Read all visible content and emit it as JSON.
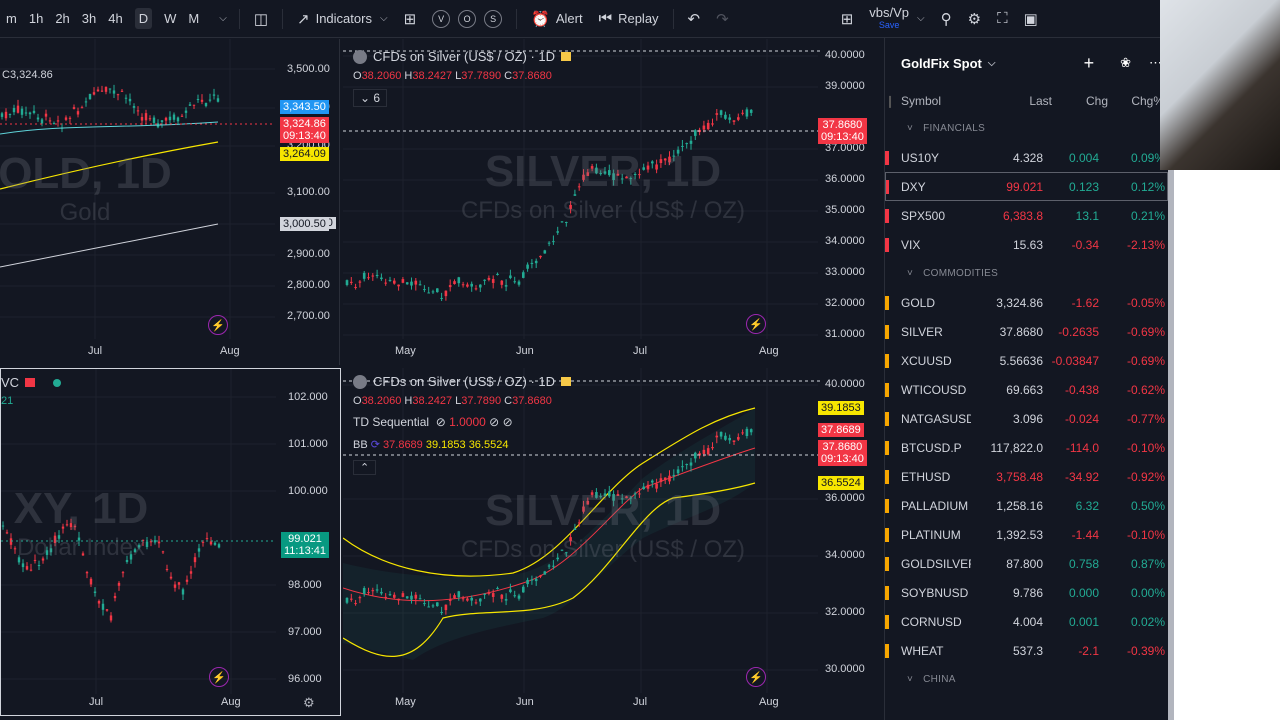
{
  "toolbar": {
    "intervals": [
      "m",
      "1h",
      "2h",
      "3h",
      "4h",
      "D",
      "W",
      "M"
    ],
    "active_interval": "D",
    "indicators": "Indicators",
    "alert": "Alert",
    "replay": "Replay",
    "layout_name": "vbs/Vp",
    "save_label": "Save",
    "circle_buttons": [
      "V",
      "O",
      "S"
    ]
  },
  "gold_pane": {
    "ohlc_fragment": "C3,324.86",
    "watermark": "OLD, 1D",
    "watermark_sub": "Gold",
    "price_scale": [
      "3,500.00",
      "3,300.00",
      "3,200.00",
      "3,100.00",
      "3,000.50",
      "2,900.00",
      "2,800.00",
      "2,700.00"
    ],
    "tags": [
      {
        "text": "3,343.50",
        "color": "#2196f3"
      },
      {
        "text": "3,324.86",
        "sub": "09:13:40",
        "color": "#f23645"
      },
      {
        "text": "3,264.09",
        "color": "#f7e600"
      },
      {
        "text": "3,000.50",
        "color": "#d1d4dc"
      }
    ],
    "x_labels": [
      "Jul",
      "Aug"
    ]
  },
  "silver_top": {
    "title": "CFDs on Silver (US$ / OZ) · 1D",
    "ohlc": {
      "o": "38.2060",
      "h": "38.2427",
      "l": "37.7890",
      "c": "37.8680"
    },
    "collapse_count": "6",
    "watermark": "SILVER, 1D",
    "watermark_sub": "CFDs on Silver (US$ / OZ)",
    "price_scale": [
      "40.0000",
      "39.0000",
      "37.0000",
      "36.0000",
      "35.0000",
      "34.0000",
      "33.0000",
      "32.0000",
      "31.0000"
    ],
    "tag": {
      "text": "37.8680",
      "sub": "09:13:40"
    },
    "x_labels": [
      "May",
      "Jun",
      "Jul",
      "Aug"
    ]
  },
  "dxy_pane": {
    "title": "VC",
    "sub": "21",
    "watermark": "XY, 1D",
    "watermark_sub": "Dollar Index",
    "price_scale": [
      "102.000",
      "101.000",
      "100.000",
      "98.000",
      "97.000",
      "96.000"
    ],
    "tag": {
      "text": "99.021",
      "sub": "11:13:41"
    },
    "x_labels": [
      "Jul",
      "Aug"
    ]
  },
  "silver_bottom": {
    "title": "CFDs on Silver (US$ / OZ) · 1D",
    "ohlc": {
      "o": "38.2060",
      "h": "38.2427",
      "l": "37.7890",
      "c": "37.8680"
    },
    "td_label": "TD Sequential",
    "td_value": "1.0000",
    "bb_label": "BB",
    "bb_values": [
      "37.8689",
      "39.1853",
      "36.5524"
    ],
    "watermark": "SILVER, 1D",
    "watermark_sub": "CFDs on Silver (US$ / OZ)",
    "price_scale": [
      "40.0000",
      "36.0000",
      "34.0000",
      "32.0000",
      "30.0000"
    ],
    "tags": [
      {
        "text": "39.1853",
        "color": "#f7e600"
      },
      {
        "text": "37.8689",
        "color": "#f23645"
      },
      {
        "text": "37.8680",
        "sub": "09:13:40",
        "color": "#f23645"
      },
      {
        "text": "36.5524",
        "color": "#f7e600"
      }
    ],
    "x_labels": [
      "May",
      "Jun",
      "Jul",
      "Aug"
    ]
  },
  "watchlist": {
    "title": "GoldFix Spot",
    "columns": [
      "Symbol",
      "Last",
      "Chg",
      "Chg%"
    ],
    "sections": [
      {
        "name": "FINANCIALS",
        "rows": [
          {
            "sym": "US10Y",
            "last": "4.328",
            "chg": "0.004",
            "chgp": "0.09%",
            "dir": "pos",
            "color": "#f23645"
          },
          {
            "sym": "DXY",
            "last": "99.021",
            "chg": "0.123",
            "chgp": "0.12%",
            "dir": "pos",
            "color": "#f23645",
            "lastneg": true,
            "sel": true
          },
          {
            "sym": "SPX500",
            "last": "6,383.8",
            "chg": "13.1",
            "chgp": "0.21%",
            "dir": "pos",
            "color": "#f23645",
            "lastneg": true
          },
          {
            "sym": "VIX",
            "last": "15.63",
            "chg": "-0.34",
            "chgp": "-2.13%",
            "dir": "neg",
            "color": "#f23645"
          }
        ]
      },
      {
        "name": "COMMODITIES",
        "rows": [
          {
            "sym": "GOLD",
            "last": "3,324.86",
            "chg": "-1.62",
            "chgp": "-0.05%",
            "dir": "neg",
            "color": "#f7a600"
          },
          {
            "sym": "SILVER",
            "last": "37.8680",
            "chg": "-0.2635",
            "chgp": "-0.69%",
            "dir": "neg",
            "color": "#f7a600"
          },
          {
            "sym": "XCUUSD",
            "last": "5.56636",
            "chg": "-0.03847",
            "chgp": "-0.69%",
            "dir": "neg",
            "color": "#f7a600"
          },
          {
            "sym": "WTICOUSD",
            "last": "69.663",
            "chg": "-0.438",
            "chgp": "-0.62%",
            "dir": "neg",
            "color": "#f7a600"
          },
          {
            "sym": "NATGASUSD",
            "last": "3.096",
            "chg": "-0.024",
            "chgp": "-0.77%",
            "dir": "neg",
            "color": "#f7a600"
          },
          {
            "sym": "BTCUSD.P",
            "last": "117,822.0",
            "chg": "-114.0",
            "chgp": "-0.10%",
            "dir": "neg",
            "color": "#f7a600"
          },
          {
            "sym": "ETHUSD",
            "last": "3,758.48",
            "chg": "-34.92",
            "chgp": "-0.92%",
            "dir": "neg",
            "color": "#f7a600",
            "lastneg": true
          },
          {
            "sym": "PALLADIUM",
            "last": "1,258.16",
            "chg": "6.32",
            "chgp": "0.50%",
            "dir": "pos",
            "color": "#f7a600"
          },
          {
            "sym": "PLATINUM",
            "last": "1,392.53",
            "chg": "-1.44",
            "chgp": "-0.10%",
            "dir": "neg",
            "color": "#f7a600"
          },
          {
            "sym": "GOLDSILVER",
            "last": "87.800",
            "chg": "0.758",
            "chgp": "0.87%",
            "dir": "pos",
            "color": "#f7a600"
          },
          {
            "sym": "SOYBNUSD",
            "last": "9.786",
            "chg": "0.000",
            "chgp": "0.00%",
            "dir": "pos",
            "color": "#f7a600"
          },
          {
            "sym": "CORNUSD",
            "last": "4.004",
            "chg": "0.001",
            "chgp": "0.02%",
            "dir": "pos",
            "color": "#f7a600"
          },
          {
            "sym": "WHEAT",
            "last": "537.3",
            "chg": "-2.1",
            "chgp": "-0.39%",
            "dir": "neg",
            "color": "#f7a600"
          }
        ]
      },
      {
        "name": "CHINA",
        "rows": []
      }
    ]
  }
}
